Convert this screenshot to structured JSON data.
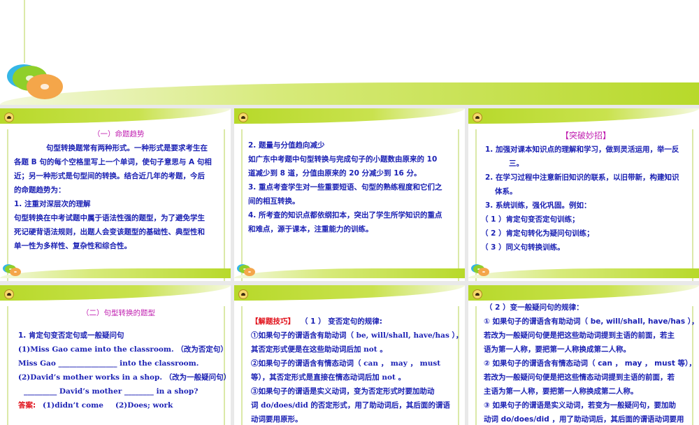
{
  "slide1": {
    "heading": "（一）命题趋势",
    "lines": [
      "句型转换题常有两种形式。一种形式是要求考生在",
      "各题 B 句的每个空格里写上一个单词，使句子意思与 A 句相",
      "近；另一种形式是句型间的转换。结合近几年的考题，今后",
      "的命题趋势为：",
      "1. 注重对深层次的理解",
      "句型转换在中考试题中属于语法性强的题型，为了避免学生",
      "死记硬背语法规则，出题人会变该题型的基础性、典型性和",
      "单一性为多样性、复杂性和综合性。"
    ]
  },
  "slide2": {
    "lines": [
      "2. 题量与分值趋向减少",
      "如广东中考题中句型转换与完成句子的小题数由原来的 10",
      "道减少到 8 道，分值由原来的 20 分减少到 16 分。",
      "3. 重点考查学生对一些重要短语、句型的熟练程度和它们之",
      "间的相互转换。",
      "4. 所考查的知识点都依纲扣本，突出了学生所学知识的重点",
      "和难点，源于课本，注重能力的训练。"
    ]
  },
  "slide3": {
    "heading": "【突破妙招】",
    "lines": [
      "1. 加强对课本知识点的理解和学习，做到灵活运用，举一反",
      "三。",
      "2. 在学习过程中注意新旧知识的联系，以旧带新，构建知识",
      "体系。",
      "3. 系统训练，强化巩固。例如：",
      "（ 1 ）肯定句变否定句训练；",
      "（ 2 ）肯定句转化为疑问句训练；",
      "（ 3 ）同义句转换训练。"
    ]
  },
  "slide4": {
    "heading": "（二）句型转换的题型",
    "lines": [
      "1.   肯定句变否定句或一般疑问句",
      "(1)Miss Gao came into the classroom. （改为否定句）",
      "Miss Gao ________________ into the classroom.",
      "(2)David’s mother works in a shop. （改为一般疑问句）",
      "_________ David’s mother ________ in a shop?"
    ],
    "answer_label": "答案:",
    "answer_1": "(1)didn’t come",
    "answer_2": "(2)Does; work"
  },
  "slide5": {
    "tip_label": "【解题技巧】",
    "tip_title": "（ 1 ） 变否定句的规律:",
    "lines": [
      "①如果句子的谓语含有助动词（ be, will/shall, have/has ），",
      "其否定形式便是在这些助动词后加 not 。",
      "②如果句子的谓语含有情态动词（ can ，  may ，  must",
      "等），其否定形式是直接在情态动词后加 not 。",
      "③如果句子的谓语是实义动词，变为否定形式时要加助动",
      "词 do/does/did 的否定形式，用了助动词后，其后面的谓语",
      "动词要用原形。"
    ]
  },
  "slide6": {
    "lines": [
      "（ 2 ）变一般疑问句的规律：",
      "① 如果句子的谓语含有助动词（ be, will/shall, have/has ），",
      "若改为一般疑问句便是把这些助动词提到主语的前面，若主",
      "语为第一人称，要把第一人称换成第二人称。",
      "② 如果句子的谓语含有情态动词（ can ，  may ，  must 等），",
      "若改为一般疑问句便是把这些情态动词提到主语的前面，若",
      "主语为第一人称，要把第一人称换成第二人称。",
      "③ 如果句子的谓语是实义动词，若变为一般疑问句，要加助",
      "动词 do/does/did ，用了助动词后，其后面的谓语动词要用"
    ]
  }
}
